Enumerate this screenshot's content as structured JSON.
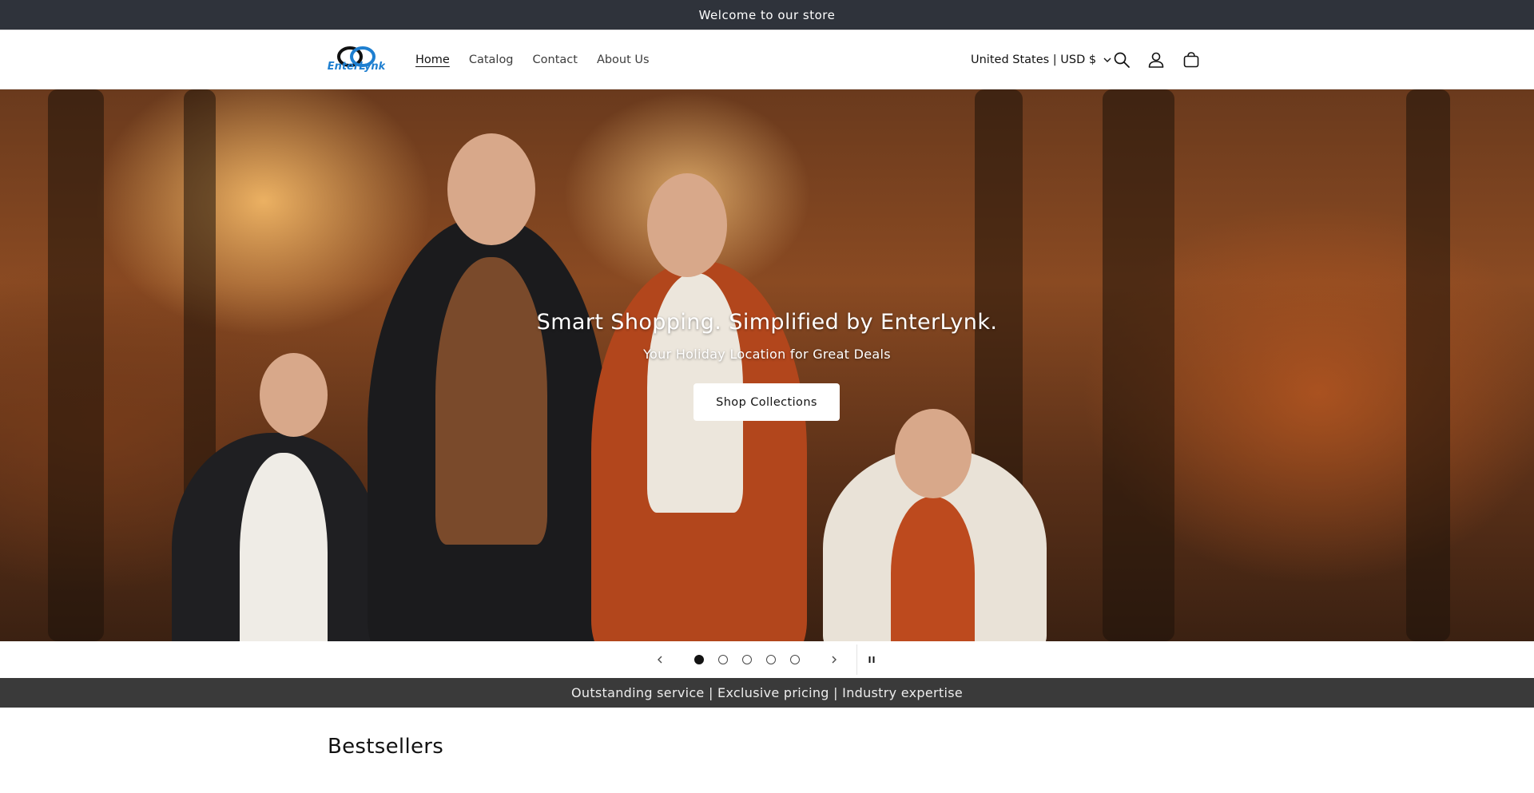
{
  "announcement": {
    "text": "Welcome to our store"
  },
  "header": {
    "logo_text": "EnterLynk",
    "nav": [
      {
        "label": "Home",
        "active": true
      },
      {
        "label": "Catalog",
        "active": false
      },
      {
        "label": "Contact",
        "active": false
      },
      {
        "label": "About Us",
        "active": false
      }
    ],
    "country_selector": "United States | USD $",
    "icons": [
      "search-icon",
      "account-icon",
      "cart-icon"
    ]
  },
  "hero": {
    "title": "Smart Shopping. Simplified by EnterLynk.",
    "subtitle": "Your Holiday Location for Great Deals",
    "button_label": "Shop Collections",
    "slides_total": 5,
    "active_slide": 1
  },
  "usp_bar": {
    "text": "Outstanding service | Exclusive pricing | Industry expertise"
  },
  "section": {
    "title": "Bestsellers"
  },
  "colors": {
    "announcement_bg": "#2f333b",
    "usp_bg": "#3a3a3a",
    "logo_blue": "#1e7fd0",
    "logo_dark": "#111111"
  }
}
